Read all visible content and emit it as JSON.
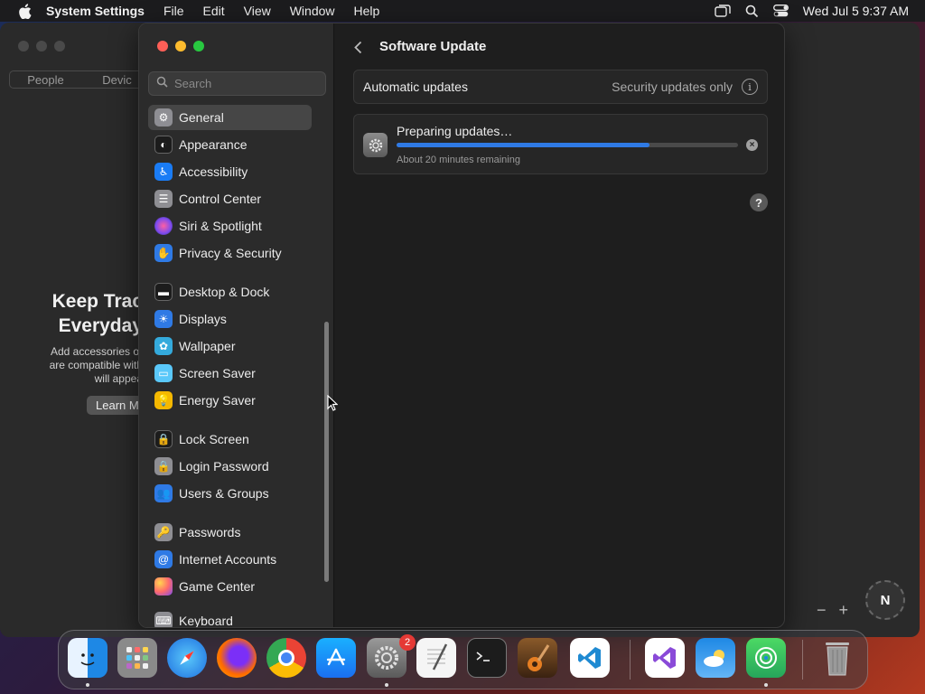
{
  "menubar": {
    "app_name": "System Settings",
    "items": [
      "File",
      "Edit",
      "View",
      "Window",
      "Help"
    ],
    "clock": "Wed Jul 5  9:37 AM"
  },
  "back_window": {
    "tabs": [
      "People",
      "Devic"
    ],
    "headline_line1": "Keep Trac",
    "headline_line2": "Everyday",
    "desc_line1": "Add accessories or",
    "desc_line2": "are compatible with",
    "desc_line3": "will appea",
    "learn_button": "Learn M",
    "zoom_out": "−",
    "zoom_in": "+",
    "compass": "N"
  },
  "sidebar": {
    "search_placeholder": "Search",
    "items": [
      {
        "label": "General",
        "icon": "gear-icon",
        "color": "#8e8e93"
      },
      {
        "label": "Appearance",
        "icon": "appearance-icon",
        "color": "#1c1c1c"
      },
      {
        "label": "Accessibility",
        "icon": "accessibility-icon",
        "color": "#1a7cf5"
      },
      {
        "label": "Control Center",
        "icon": "control-center-icon",
        "color": "#8e8e93"
      },
      {
        "label": "Siri & Spotlight",
        "icon": "siri-icon",
        "color": "#b14bd9"
      },
      {
        "label": "Privacy & Security",
        "icon": "hand-icon",
        "color": "#2f7ae5"
      },
      {
        "label": "Desktop & Dock",
        "icon": "dock-icon",
        "color": "#1c1c1c"
      },
      {
        "label": "Displays",
        "icon": "sun-icon",
        "color": "#2f7ae5"
      },
      {
        "label": "Wallpaper",
        "icon": "flower-icon",
        "color": "#34aadc"
      },
      {
        "label": "Screen Saver",
        "icon": "screen-saver-icon",
        "color": "#5ac8fa"
      },
      {
        "label": "Energy Saver",
        "icon": "bulb-icon",
        "color": "#f5b800"
      },
      {
        "label": "Lock Screen",
        "icon": "lock-icon",
        "color": "#1c1c1c"
      },
      {
        "label": "Login Password",
        "icon": "padlock-icon",
        "color": "#8e8e93"
      },
      {
        "label": "Users & Groups",
        "icon": "users-icon",
        "color": "#2f7ae5"
      },
      {
        "label": "Passwords",
        "icon": "key-icon",
        "color": "#8e8e93"
      },
      {
        "label": "Internet Accounts",
        "icon": "at-icon",
        "color": "#2f7ae5"
      },
      {
        "label": "Game Center",
        "icon": "game-center-icon",
        "color": "#ff6b6b"
      },
      {
        "label": "Keyboard",
        "icon": "keyboard-icon",
        "color": "#8e8e93"
      }
    ]
  },
  "content": {
    "title": "Software Update",
    "automatic_updates_label": "Automatic updates",
    "automatic_updates_value": "Security updates only",
    "info_glyph": "i",
    "status": "Preparing updates…",
    "remaining": "About 20 minutes remaining",
    "progress": 0.74,
    "cancel_glyph": "×",
    "help_glyph": "?"
  },
  "dock": {
    "apps": [
      "Finder",
      "Launchpad",
      "Safari",
      "Firefox",
      "Google Chrome",
      "App Store",
      "System Settings",
      "TextEdit",
      "Terminal",
      "GarageBand",
      "Visual Studio Code",
      "Visual Studio",
      "Weather",
      "Find My",
      "Trash"
    ],
    "system_settings_badge": "2"
  }
}
